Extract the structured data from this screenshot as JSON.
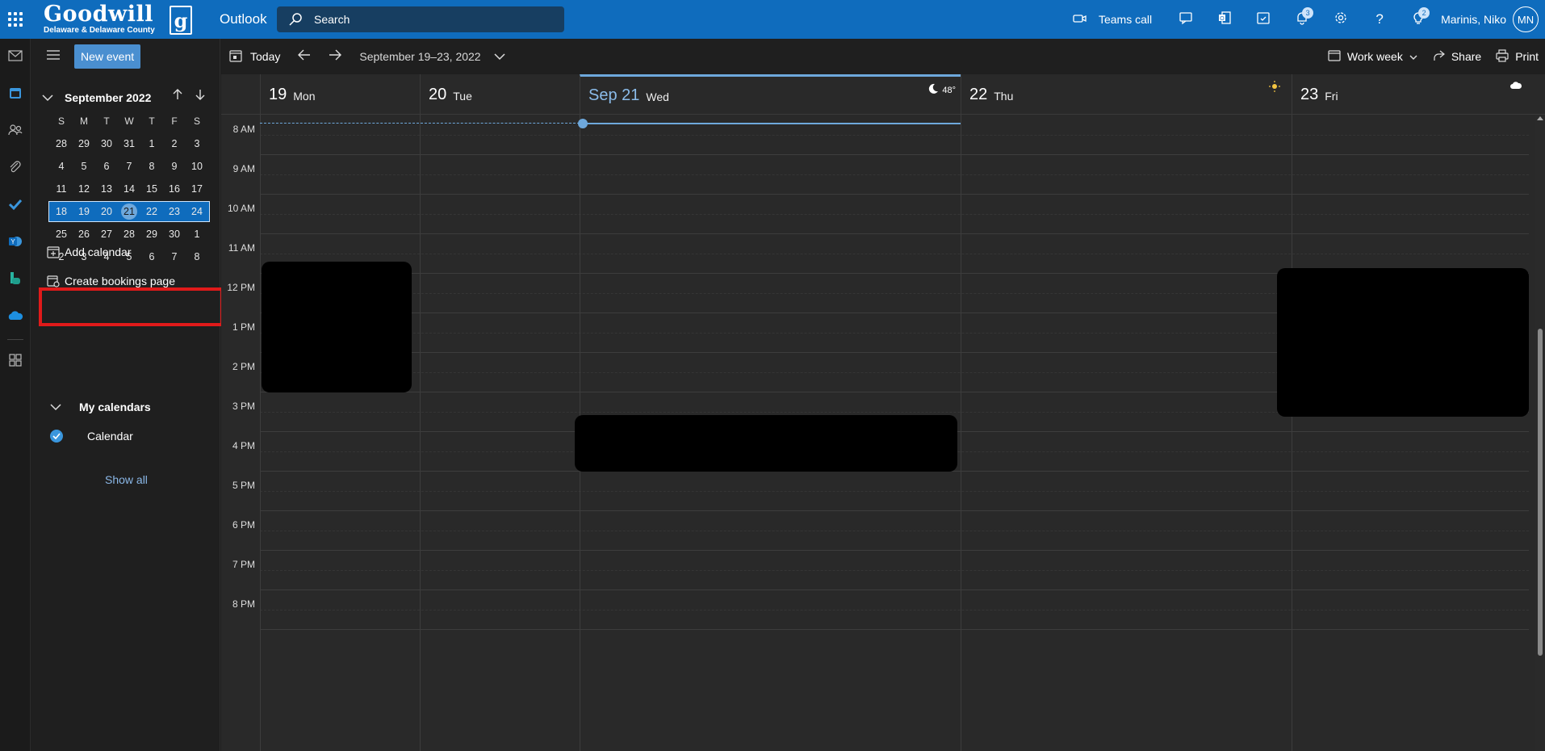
{
  "header": {
    "logo_main": "Goodwill",
    "logo_sub": "Delaware & Delaware County",
    "logo_mark": "g",
    "app_name": "Outlook",
    "search_placeholder": "Search",
    "teams_call": "Teams call",
    "notifications_badge": "3",
    "tips_badge": "2",
    "user_name": "Marinis, Niko",
    "user_initials": "MN"
  },
  "rail": {
    "items": [
      "mail-icon",
      "calendar-icon",
      "people-icon",
      "attachment-icon",
      "todo-icon",
      "yammer-icon",
      "bookings-icon",
      "onedrive-icon",
      "apps-icon"
    ]
  },
  "sidebar": {
    "new_event": "New event",
    "month_title": "September 2022",
    "dow": [
      "S",
      "M",
      "T",
      "W",
      "T",
      "F",
      "S"
    ],
    "weeks": [
      [
        "28",
        "29",
        "30",
        "31",
        "1",
        "2",
        "3"
      ],
      [
        "4",
        "5",
        "6",
        "7",
        "8",
        "9",
        "10"
      ],
      [
        "11",
        "12",
        "13",
        "14",
        "15",
        "16",
        "17"
      ],
      [
        "18",
        "19",
        "20",
        "21",
        "22",
        "23",
        "24"
      ],
      [
        "25",
        "26",
        "27",
        "28",
        "29",
        "30",
        "1"
      ],
      [
        "2",
        "3",
        "4",
        "5",
        "6",
        "7",
        "8"
      ]
    ],
    "selected_week_index": 3,
    "today_day": "21",
    "add_calendar": "Add calendar",
    "create_bookings": "Create bookings page",
    "my_calendars": "My calendars",
    "calendar_item": "Calendar",
    "show_all": "Show all"
  },
  "toolbar": {
    "today": "Today",
    "range": "September 19–23, 2022",
    "view": "Work week",
    "share": "Share",
    "print": "Print"
  },
  "days": [
    {
      "num": "19",
      "name": "Mon"
    },
    {
      "num": "20",
      "name": "Tue"
    },
    {
      "num": "Sep 21",
      "name": "Wed",
      "today": true,
      "weather": "48°",
      "weather_icon": "moon-icon"
    },
    {
      "num": "22",
      "name": "Thu",
      "weather_icon": "sun-icon"
    },
    {
      "num": "23",
      "name": "Fri",
      "weather_icon": "cloud-icon"
    }
  ],
  "times": [
    "8 AM",
    "9 AM",
    "10 AM",
    "11 AM",
    "12 PM",
    "1 PM",
    "2 PM",
    "3 PM",
    "4 PM",
    "5 PM",
    "6 PM",
    "7 PM",
    "8 PM"
  ],
  "colors": {
    "brand": "#0f6cbd",
    "accent": "#6ea8dc",
    "highlight": "#e01a1a"
  }
}
